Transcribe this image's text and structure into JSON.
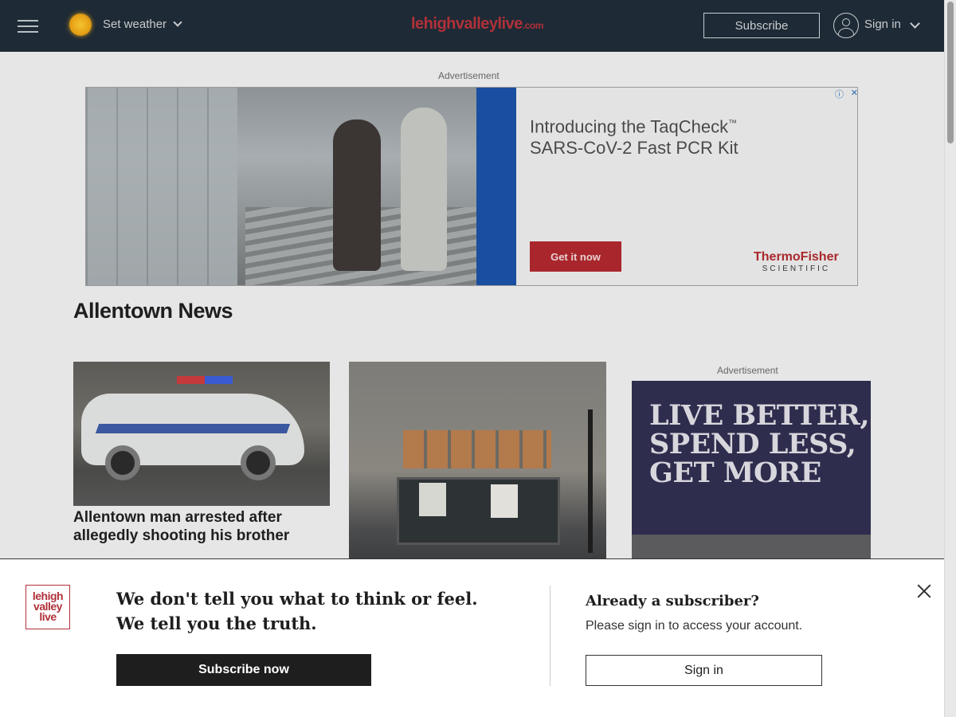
{
  "header": {
    "menu_icon": "hamburger-icon",
    "weather_icon": "sun-icon",
    "weather_label": "Set weather",
    "logo_main": "lehighvalleylive",
    "logo_suffix": ".com",
    "subscribe_label": "Subscribe",
    "user_icon": "user-icon",
    "signin_label": "Sign in",
    "background": "#1e2a35"
  },
  "top_ad": {
    "label": "Advertisement",
    "headline_line1": "Introducing the TaqCheck",
    "trademark": "™",
    "headline_line2": "SARS-CoV-2 Fast PCR Kit",
    "cta": "Get it now",
    "brand": "ThermoFisher",
    "brand_sub": "SCIENTIFIC",
    "ad_choices": "ⓘ",
    "ad_close": "✕",
    "accent": "#a9272c"
  },
  "section": {
    "title": "Allentown News"
  },
  "articles": [
    {
      "title": "Allentown man arrested after allegedly shooting his brother"
    }
  ],
  "side_ad": {
    "label": "Advertisement",
    "text": "LIVE BETTER, SPEND LESS, GET MORE"
  },
  "overlay": {
    "logo_line1": "lehigh",
    "logo_line2": "valley",
    "logo_line3": "live",
    "headline_line1": "We don't tell you what to think or feel.",
    "headline_line2": "We tell you the truth.",
    "subscribe_cta": "Subscribe now",
    "already": "Already a subscriber?",
    "please": "Please sign in to access your account.",
    "signin_cta": "Sign in",
    "close_icon": "close-icon"
  }
}
